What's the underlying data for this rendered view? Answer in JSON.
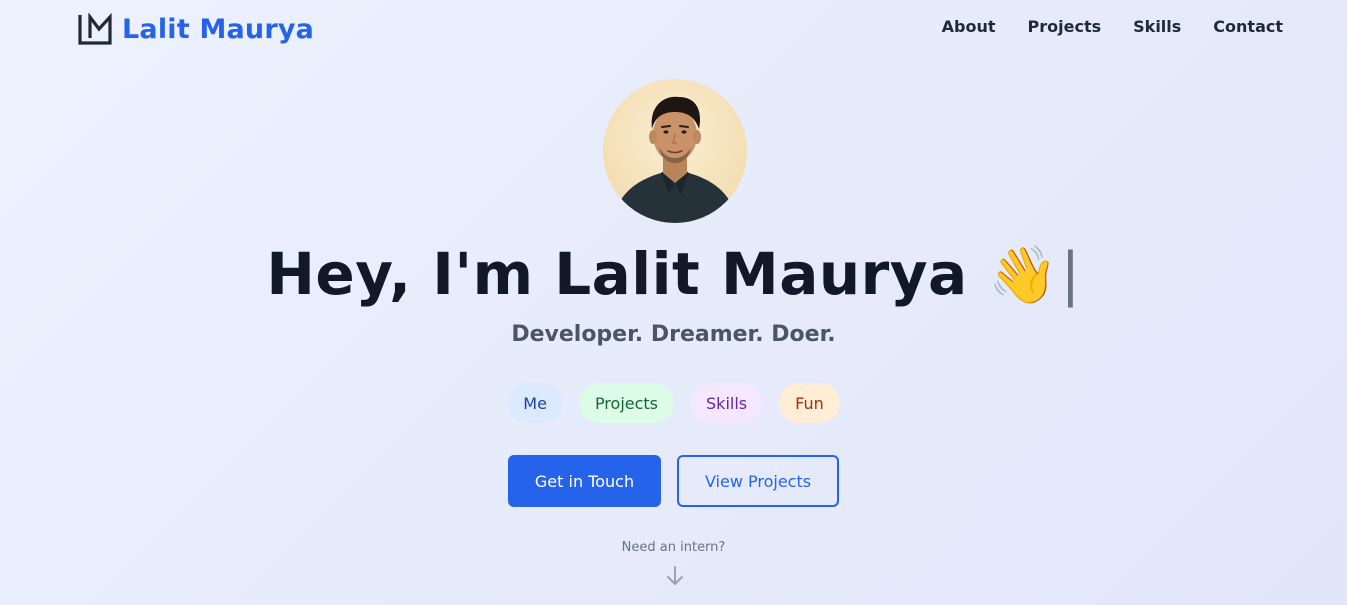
{
  "header": {
    "brand_name": "Lalit Maurya",
    "logo_icon": "lm-monogram-icon",
    "nav": [
      {
        "label": "About"
      },
      {
        "label": "Projects"
      },
      {
        "label": "Skills"
      },
      {
        "label": "Contact"
      }
    ]
  },
  "hero": {
    "headline": "Hey, I'm Lalit Maurya",
    "headline_emoji": "👋",
    "typing_cursor": "|",
    "tagline": "Developer. Dreamer. Doer.",
    "pills": [
      {
        "label": "Me"
      },
      {
        "label": "Projects"
      },
      {
        "label": "Skills"
      },
      {
        "label": "Fun"
      }
    ],
    "primary_cta": "Get in Touch",
    "secondary_cta": "View Projects",
    "intern_prompt": "Need an intern?",
    "scroll_icon": "arrow-down-icon"
  },
  "colors": {
    "accent": "#2563eb",
    "heading": "#111827",
    "pill_me_bg": "#dbeafe",
    "pill_projects_bg": "#dcfce7",
    "pill_skills_bg": "#f3e8ff",
    "pill_fun_bg": "#ffedd5"
  }
}
